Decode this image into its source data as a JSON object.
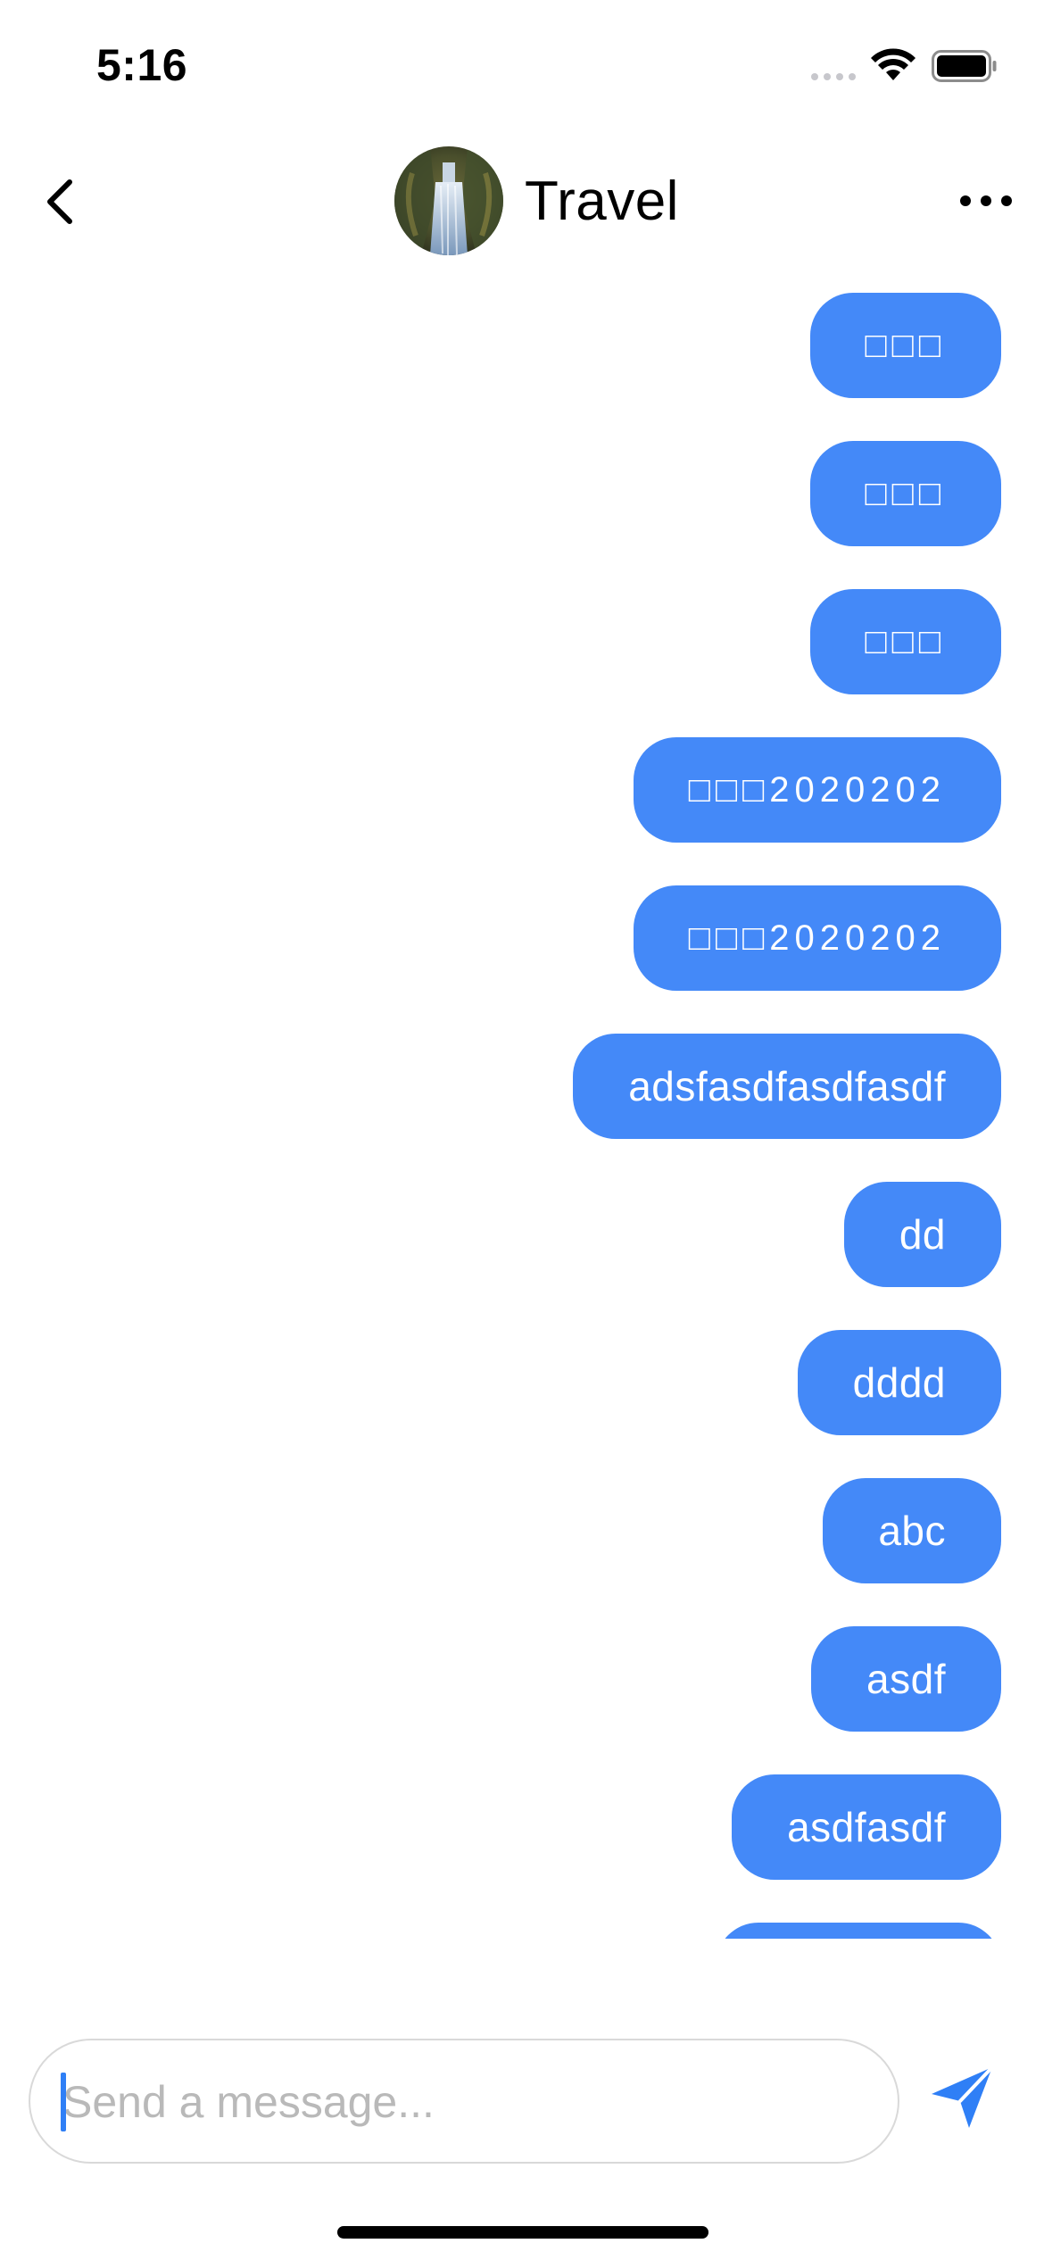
{
  "status_bar": {
    "time": "5:16"
  },
  "header": {
    "title": "Travel",
    "back_icon": "chevron-left-icon",
    "more_icon": "more-horizontal-icon"
  },
  "messages": [
    {
      "text": "□□□",
      "from": "me"
    },
    {
      "text": "□□□",
      "from": "me"
    },
    {
      "text": "□□□",
      "from": "me"
    },
    {
      "text": "□□□2020202",
      "from": "me"
    },
    {
      "text": "□□□2020202",
      "from": "me"
    },
    {
      "text": "adsfasdfasdfasdf",
      "from": "me"
    },
    {
      "text": "dd",
      "from": "me"
    },
    {
      "text": "dddd",
      "from": "me"
    },
    {
      "text": "abc",
      "from": "me"
    },
    {
      "text": "asdf",
      "from": "me"
    },
    {
      "text": "asdfasdf",
      "from": "me"
    }
  ],
  "composer": {
    "placeholder": "Send a message...",
    "value": "",
    "send_icon": "send-icon"
  },
  "colors": {
    "bubble": "#4489f8",
    "accent": "#2f7ff6"
  }
}
